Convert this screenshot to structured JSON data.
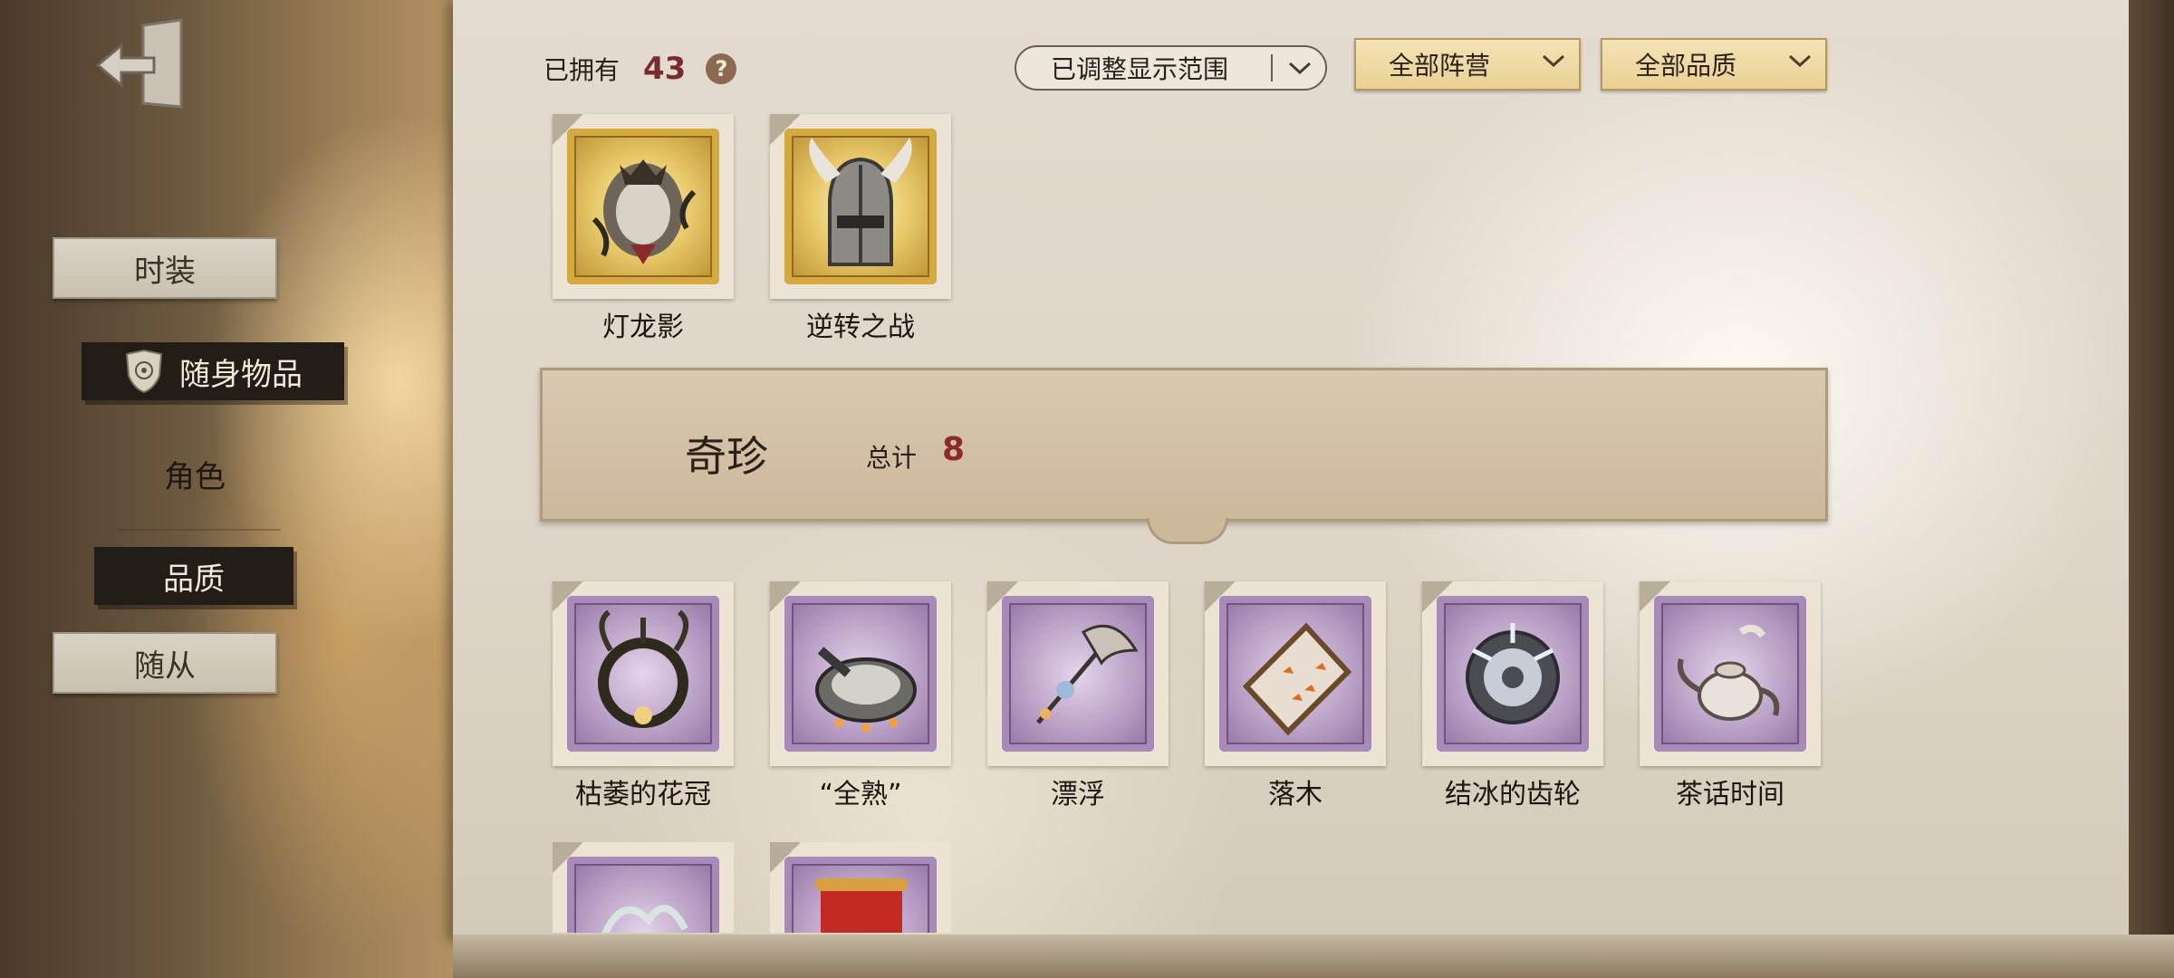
{
  "sidebar": {
    "exit_icon": "exit-door-icon",
    "items": [
      {
        "label": "时装",
        "style": "light"
      },
      {
        "label": "随身物品",
        "style": "dark",
        "icon": "shield-emblem-icon"
      },
      {
        "label": "角色",
        "style": "plain"
      },
      {
        "label": "品质",
        "style": "dark"
      },
      {
        "label": "随从",
        "style": "light"
      }
    ]
  },
  "header": {
    "owned_label": "已拥有",
    "owned_count": "43",
    "help_icon": "?",
    "filters": {
      "range": "已调整显示范围",
      "camp": "全部阵营",
      "quality": "全部品质"
    }
  },
  "top_items": [
    {
      "name": "灯龙影",
      "rarity": "gold",
      "icon": "lantern-dragon-icon"
    },
    {
      "name": "逆转之战",
      "rarity": "gold",
      "icon": "winged-helmet-icon"
    }
  ],
  "section": {
    "title": "奇珍",
    "total_label": "总计",
    "total_count": "8"
  },
  "section_items": [
    {
      "name": "枯萎的花冠",
      "rarity": "purple",
      "icon": "withered-wreath-icon"
    },
    {
      "name": "“全熟”",
      "rarity": "purple",
      "icon": "frying-pan-icon"
    },
    {
      "name": "漂浮",
      "rarity": "purple",
      "icon": "floating-parasol-icon"
    },
    {
      "name": "落木",
      "rarity": "purple",
      "icon": "falling-leaves-frame-icon"
    },
    {
      "name": "结冰的齿轮",
      "rarity": "purple",
      "icon": "frozen-gear-icon"
    },
    {
      "name": "茶话时间",
      "rarity": "purple",
      "icon": "teapot-icon"
    }
  ],
  "partial_items": [
    {
      "rarity": "purple",
      "icon": "antler-icon"
    },
    {
      "rarity": "purple",
      "icon": "red-scroll-icon"
    }
  ],
  "colors": {
    "accent_gold": "#e9cf94",
    "count_red": "#8a2a2a",
    "purple_stamp": "#b79dc3"
  }
}
